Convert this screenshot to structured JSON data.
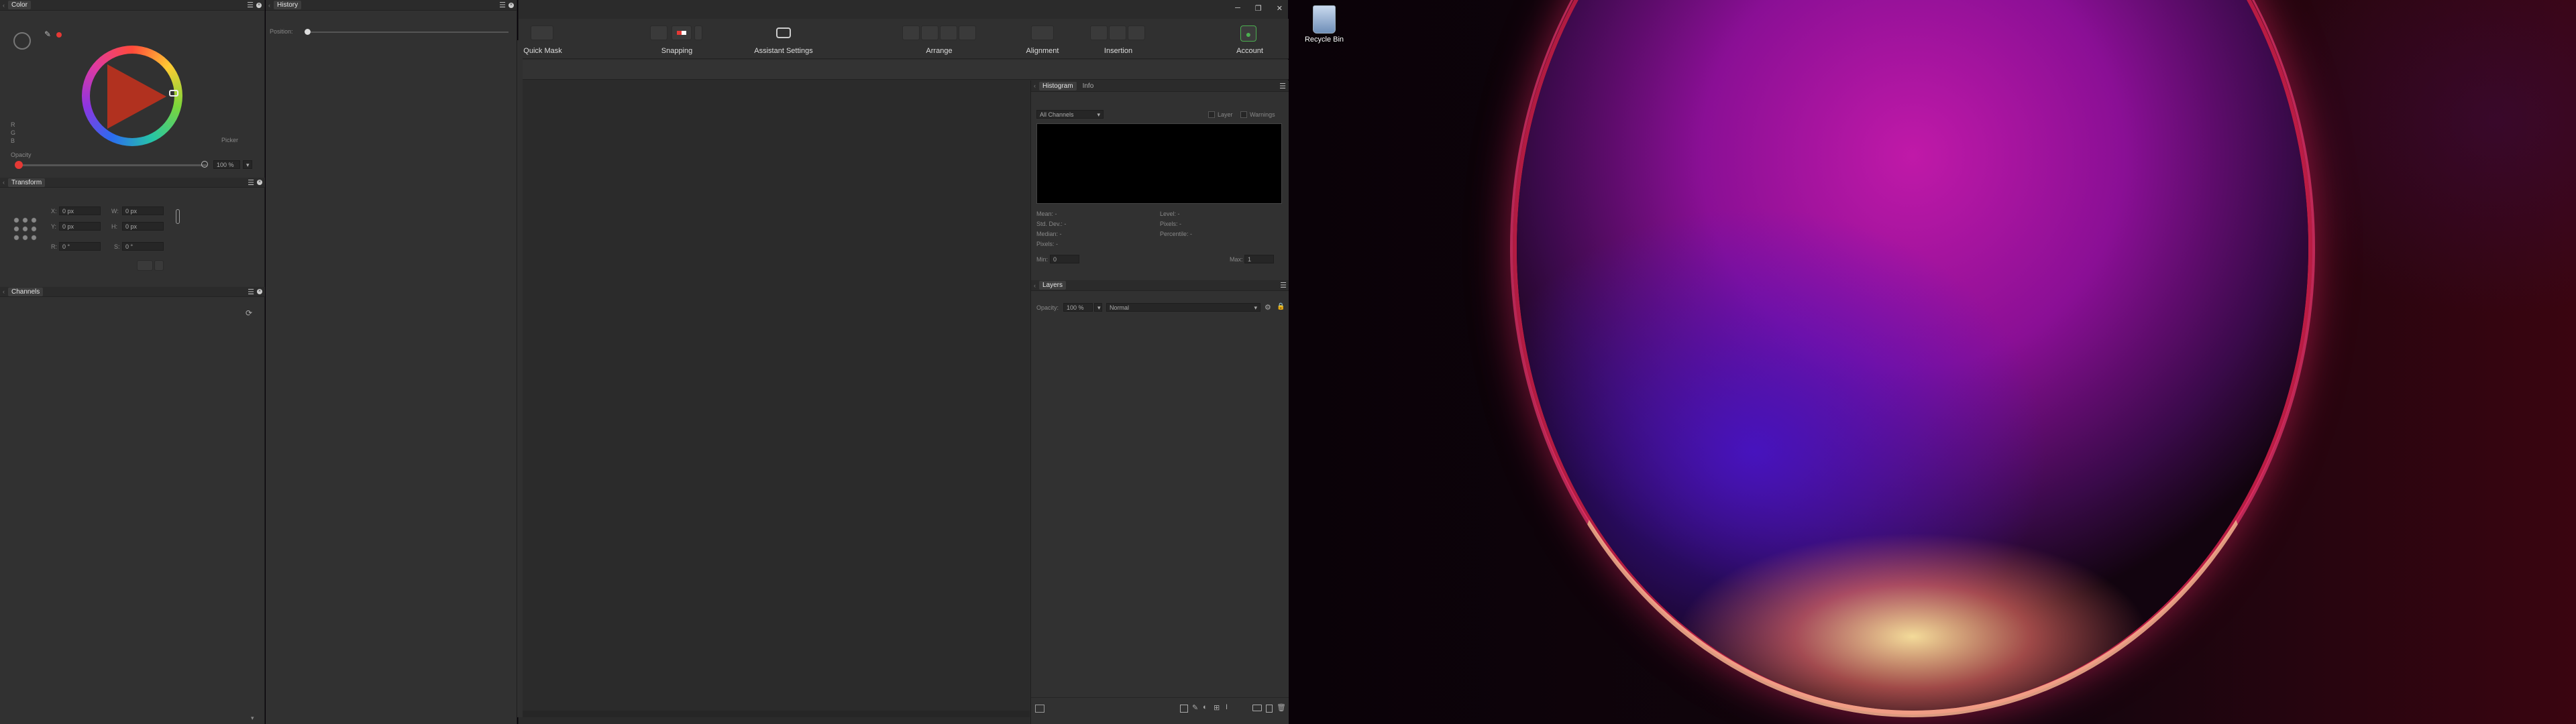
{
  "color_panel": {
    "tab": "Color",
    "picker_label": "Picker",
    "opacity_label": "Opacity",
    "opacity_value": "100 %",
    "rgb_labels": [
      "R",
      "G",
      "B"
    ]
  },
  "history_panel": {
    "tab": "History",
    "position_label": "Position:"
  },
  "transform_panel": {
    "tab": "Transform",
    "x_label": "X:",
    "x_value": "0 px",
    "y_label": "Y:",
    "y_value": "0 px",
    "w_label": "W:",
    "w_value": "0 px",
    "h_label": "H:",
    "h_value": "0 px",
    "r_label": "R:",
    "r_value": "0 °",
    "s_label": "S:",
    "s_value": "0 °"
  },
  "channels_panel": {
    "tab": "Channels"
  },
  "toolbar": {
    "quick_mask": "Quick Mask",
    "snapping": "Snapping",
    "assistant": "Assistant Settings",
    "arrange": "Arrange",
    "alignment": "Alignment",
    "insertion": "Insertion",
    "account": "Account"
  },
  "histogram_panel": {
    "tab_histogram": "Histogram",
    "tab_info": "Info",
    "channels_select": "All Channels",
    "layer_label": "Layer",
    "warnings_label": "Warnings",
    "stats_left": [
      "Mean: -",
      "Std. Dev.: -",
      "Median: -",
      "Pixels: -"
    ],
    "stats_right": [
      "Level: -",
      "Pixels: -",
      "Percentile: -"
    ],
    "min_label": "Min:",
    "min_value": "0",
    "max_label": "Max:",
    "max_value": "1"
  },
  "layers_panel": {
    "tab": "Layers",
    "opacity_label": "Opacity:",
    "opacity_value": "100 %",
    "blend_mode": "Normal"
  },
  "desktop": {
    "recycle_bin": "Recycle Bin"
  },
  "colors": {
    "accent": "#4caf50",
    "panel": "#313131",
    "canvas": "#2b2b2b"
  }
}
